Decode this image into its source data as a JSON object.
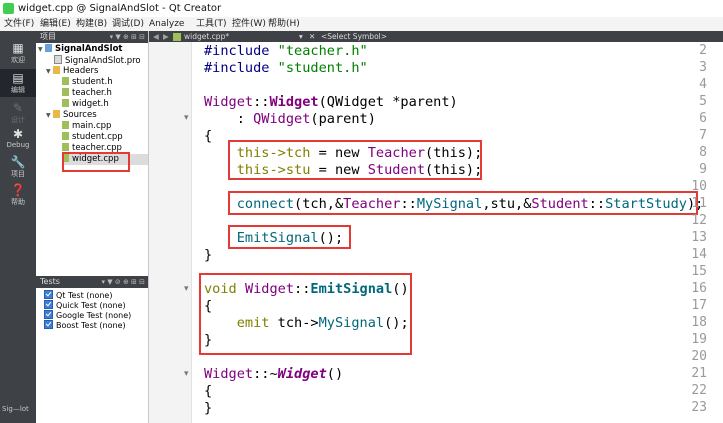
{
  "window": {
    "title": "widget.cpp @ SignalAndSlot - Qt Creator"
  },
  "menu": [
    "文件(F)",
    "编辑(E)",
    "构建(B)",
    "调试(D)",
    "Analyze",
    "工具(T)",
    "控件(W)",
    "帮助(H)"
  ],
  "modes": [
    {
      "label": "欢迎",
      "icon": "grid-icon"
    },
    {
      "label": "编辑",
      "icon": "edit-icon"
    },
    {
      "label": "设计",
      "icon": "pencil-icon"
    },
    {
      "label": "Debug",
      "icon": "bug-icon"
    },
    {
      "label": "项目",
      "icon": "wrench-icon"
    },
    {
      "label": "帮助",
      "icon": "help-icon"
    }
  ],
  "run_target": "Sig—lot",
  "projects_pane": {
    "title": "项目",
    "tree": [
      {
        "label": "SignalAndSlot",
        "kind": "project"
      },
      {
        "label": "SignalAndSlot.pro",
        "kind": "pro"
      },
      {
        "label": "Headers",
        "kind": "folder"
      },
      {
        "label": "student.h",
        "kind": "header"
      },
      {
        "label": "teacher.h",
        "kind": "header"
      },
      {
        "label": "widget.h",
        "kind": "header"
      },
      {
        "label": "Sources",
        "kind": "folder"
      },
      {
        "label": "main.cpp",
        "kind": "source"
      },
      {
        "label": "student.cpp",
        "kind": "source"
      },
      {
        "label": "teacher.cpp",
        "kind": "source"
      },
      {
        "label": "widget.cpp",
        "kind": "source",
        "selected": true
      }
    ]
  },
  "tests_pane": {
    "title": "Tests",
    "items": [
      "Qt Test (none)",
      "Quick Test (none)",
      "Google Test (none)",
      "Boost Test (none)"
    ]
  },
  "editor_tabs": {
    "file": "widget.cpp*",
    "symbol": "<Select Symbol>"
  },
  "editor": {
    "line_numbers": [
      "2",
      "3",
      "4",
      "5",
      "6",
      "7",
      "8",
      "9",
      "10",
      "11",
      "12",
      "13",
      "14",
      "15",
      "16",
      "17",
      "18",
      "19",
      "20",
      "21",
      "22",
      "23"
    ],
    "tokens": {
      "include": "#include",
      "teacher_h": "\"teacher.h\"",
      "student_h": "\"student.h\"",
      "widget": "Widget",
      "sep": "::",
      "qwidget": "QWidget",
      "parent_param": "(QWidget *parent)",
      "init": ": ",
      "parent_call": "(parent)",
      "brace_open": "{",
      "brace_close": "}",
      "this_tch": "this->tch",
      "this_stu": "this->stu",
      "assign_new": " = new ",
      "teacher": "Teacher",
      "student": "Student",
      "this_arg": "(this);",
      "connect": "connect",
      "connect_args1": "(tch,&",
      "mysignal": "MySignal",
      "connect_args2": ",stu,&",
      "startstudy": "StartStudy",
      "close_paren_semi": ");",
      "emitsignal": "EmitSignal",
      "call_end": "();",
      "void": "void",
      "emit_kw": "emit",
      "tch_arrow": " tch->",
      "empty_parens": "()",
      "tilde": "~"
    }
  },
  "colors": {
    "highlight_box": "#e53935",
    "modebar_bg": "#3e4146"
  }
}
